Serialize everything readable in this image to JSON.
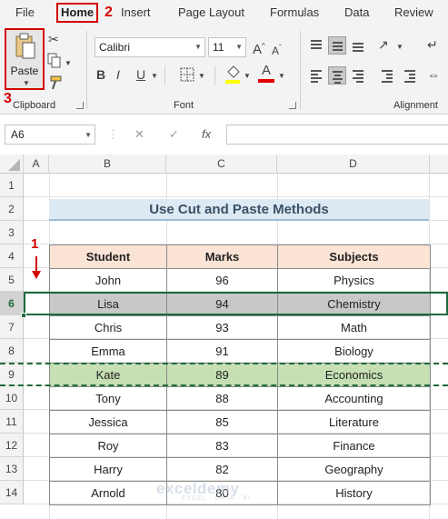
{
  "tabs": [
    "File",
    "Home",
    "Insert",
    "Page Layout",
    "Formulas",
    "Data",
    "Review"
  ],
  "annotations": {
    "home_step": "2",
    "paste_step": "3",
    "row_step": "1"
  },
  "ribbon": {
    "paste_label": "Paste",
    "clipboard_label": "Clipboard",
    "font_label": "Font",
    "alignment_label": "Alignment",
    "font_name": "Calibri",
    "font_size": "11",
    "grow_font": "A",
    "shrink_font": "A",
    "bold": "B",
    "italic": "I",
    "underline": "U",
    "font_color_letter": "A"
  },
  "formula_bar": {
    "name_box": "A6",
    "fx": "fx",
    "value": ""
  },
  "columns": [
    "A",
    "B",
    "C",
    "D"
  ],
  "rows": [
    "1",
    "2",
    "3",
    "4",
    "5",
    "6",
    "7",
    "8",
    "9",
    "10",
    "11",
    "12",
    "13",
    "14"
  ],
  "title": "Use Cut and Paste Methods",
  "table": {
    "headers": [
      "Student",
      "Marks",
      "Subjects"
    ],
    "rows": [
      [
        "John",
        "96",
        "Physics"
      ],
      [
        "Lisa",
        "94",
        "Chemistry"
      ],
      [
        "Chris",
        "93",
        "Math"
      ],
      [
        "Emma",
        "91",
        "Biology"
      ],
      [
        "Kate",
        "89",
        "Economics"
      ],
      [
        "Tony",
        "88",
        "Accounting"
      ],
      [
        "Jessica",
        "85",
        "Literature"
      ],
      [
        "Roy",
        "83",
        "Finance"
      ],
      [
        "Harry",
        "82",
        "Geography"
      ],
      [
        "Arnold",
        "80",
        "History"
      ]
    ]
  },
  "state": {
    "active_row": "6",
    "cut_row": "9"
  },
  "colors": {
    "header_fill": "#fbe4d5",
    "cut_fill": "#c8c8c8",
    "paste_fill": "#c6e0b4",
    "selection": "#1e6b3c",
    "title_fill": "#dde9f3",
    "annotation": "#d40000"
  },
  "watermark": {
    "brand": "exceldemy",
    "tagline": "EXCEL · DATA · BI"
  }
}
